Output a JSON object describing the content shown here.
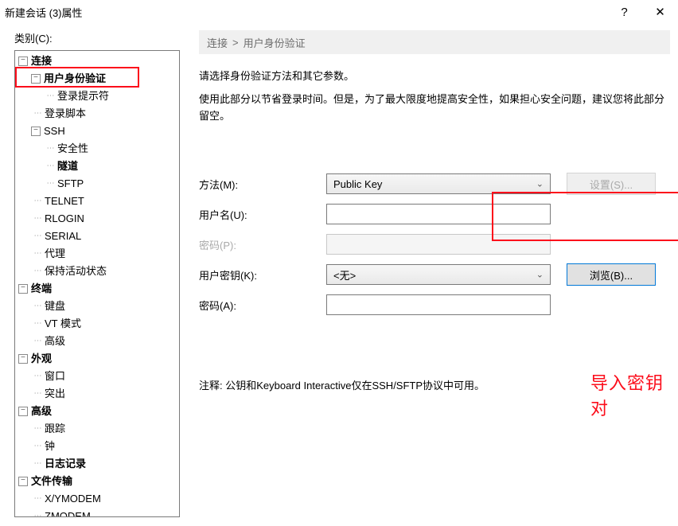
{
  "window": {
    "title": "新建会话 (3)属性",
    "help_icon": "?",
    "close_icon": "✕"
  },
  "sidebar": {
    "label": "类别(C):",
    "tree": [
      {
        "depth": 0,
        "toggle": "−",
        "label": "连接",
        "bold": true
      },
      {
        "depth": 1,
        "toggle": "−",
        "label": "用户身份验证",
        "bold": true
      },
      {
        "depth": 2,
        "toggle": "",
        "label": "登录提示符",
        "bold": false
      },
      {
        "depth": 1,
        "toggle": "",
        "label": "登录脚本",
        "bold": false
      },
      {
        "depth": 1,
        "toggle": "−",
        "label": "SSH",
        "bold": false
      },
      {
        "depth": 2,
        "toggle": "",
        "label": "安全性",
        "bold": false
      },
      {
        "depth": 2,
        "toggle": "",
        "label": "隧道",
        "bold": true
      },
      {
        "depth": 2,
        "toggle": "",
        "label": "SFTP",
        "bold": false
      },
      {
        "depth": 1,
        "toggle": "",
        "label": "TELNET",
        "bold": false
      },
      {
        "depth": 1,
        "toggle": "",
        "label": "RLOGIN",
        "bold": false
      },
      {
        "depth": 1,
        "toggle": "",
        "label": "SERIAL",
        "bold": false
      },
      {
        "depth": 1,
        "toggle": "",
        "label": "代理",
        "bold": false
      },
      {
        "depth": 1,
        "toggle": "",
        "label": "保持活动状态",
        "bold": false
      },
      {
        "depth": 0,
        "toggle": "−",
        "label": "终端",
        "bold": true
      },
      {
        "depth": 1,
        "toggle": "",
        "label": "键盘",
        "bold": false
      },
      {
        "depth": 1,
        "toggle": "",
        "label": "VT 模式",
        "bold": false
      },
      {
        "depth": 1,
        "toggle": "",
        "label": "高级",
        "bold": false
      },
      {
        "depth": 0,
        "toggle": "−",
        "label": "外观",
        "bold": true
      },
      {
        "depth": 1,
        "toggle": "",
        "label": "窗口",
        "bold": false
      },
      {
        "depth": 1,
        "toggle": "",
        "label": "突出",
        "bold": false
      },
      {
        "depth": 0,
        "toggle": "−",
        "label": "高级",
        "bold": true
      },
      {
        "depth": 1,
        "toggle": "",
        "label": "跟踪",
        "bold": false
      },
      {
        "depth": 1,
        "toggle": "",
        "label": "钟",
        "bold": false
      },
      {
        "depth": 1,
        "toggle": "",
        "label": "日志记录",
        "bold": true
      },
      {
        "depth": 0,
        "toggle": "−",
        "label": "文件传输",
        "bold": true
      },
      {
        "depth": 1,
        "toggle": "",
        "label": "X/YMODEM",
        "bold": false
      },
      {
        "depth": 1,
        "toggle": "",
        "label": "ZMODEM",
        "bold": false
      }
    ]
  },
  "breadcrumb": {
    "root": "连接",
    "sep": ">",
    "current": "用户身份验证"
  },
  "intro": {
    "line1": "请选择身份验证方法和其它参数。",
    "line2": "使用此部分以节省登录时间。但是，为了最大限度地提高安全性，如果担心安全问题，建议您将此部分留空。"
  },
  "form": {
    "method_label": "方法(M):",
    "method_value": "Public Key",
    "settings_btn": "设置(S)...",
    "username_label": "用户名(U):",
    "username_value": "",
    "password_label": "密码(P):",
    "password_value": "",
    "userkey_label": "用户密钥(K):",
    "userkey_value": "<无>",
    "browse_btn": "浏览(B)...",
    "passphrase_label": "密码(A):",
    "passphrase_value": ""
  },
  "annotation": "导入密钥对",
  "note": "注释: 公钥和Keyboard Interactive仅在SSH/SFTP协议中可用。"
}
